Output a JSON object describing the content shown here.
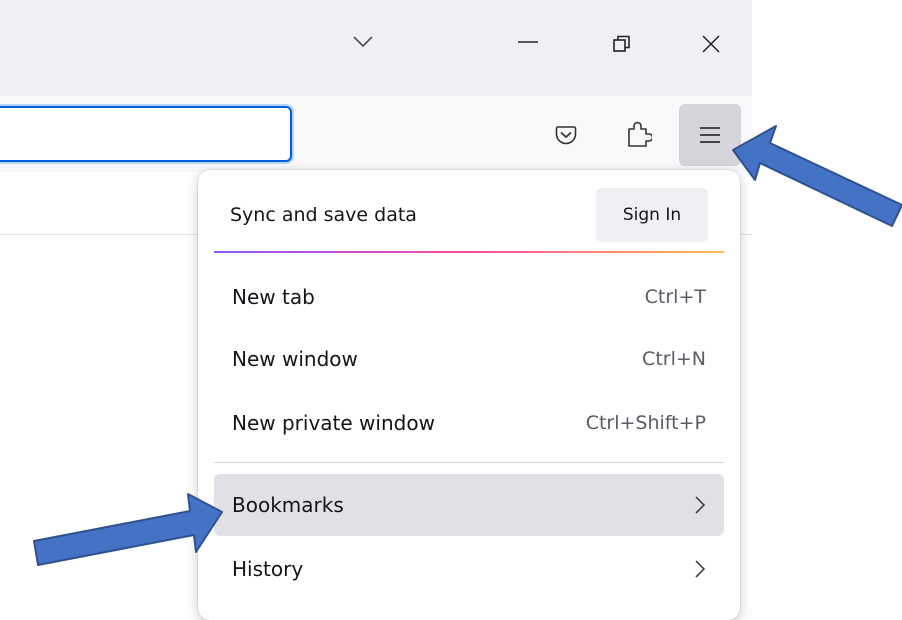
{
  "window": {
    "tab_list_icon": "chevron-down-icon",
    "minimize_icon": "minimize-icon",
    "restore_icon": "restore-icon",
    "close_icon": "close-icon"
  },
  "toolbar": {
    "url_value": "",
    "pocket_icon": "pocket-icon",
    "extensions_icon": "extensions-icon",
    "menu_icon": "hamburger-menu-icon"
  },
  "menu": {
    "sync_label": "Sync and save data",
    "sign_in_label": "Sign In",
    "items": [
      {
        "label": "New tab",
        "shortcut": "Ctrl+T"
      },
      {
        "label": "New window",
        "shortcut": "Ctrl+N"
      },
      {
        "label": "New private window",
        "shortcut": "Ctrl+Shift+P"
      },
      {
        "label": "Bookmarks",
        "submenu": true
      },
      {
        "label": "History",
        "submenu": true
      }
    ]
  },
  "annotations": {
    "arrow_color": "#4472c4",
    "arrow_targets": [
      "hamburger-menu-button",
      "bookmarks-menu-item"
    ]
  },
  "colors": {
    "accent": "#0060df",
    "titlebar": "#f0f0f4",
    "hover": "#e0e0e6"
  }
}
